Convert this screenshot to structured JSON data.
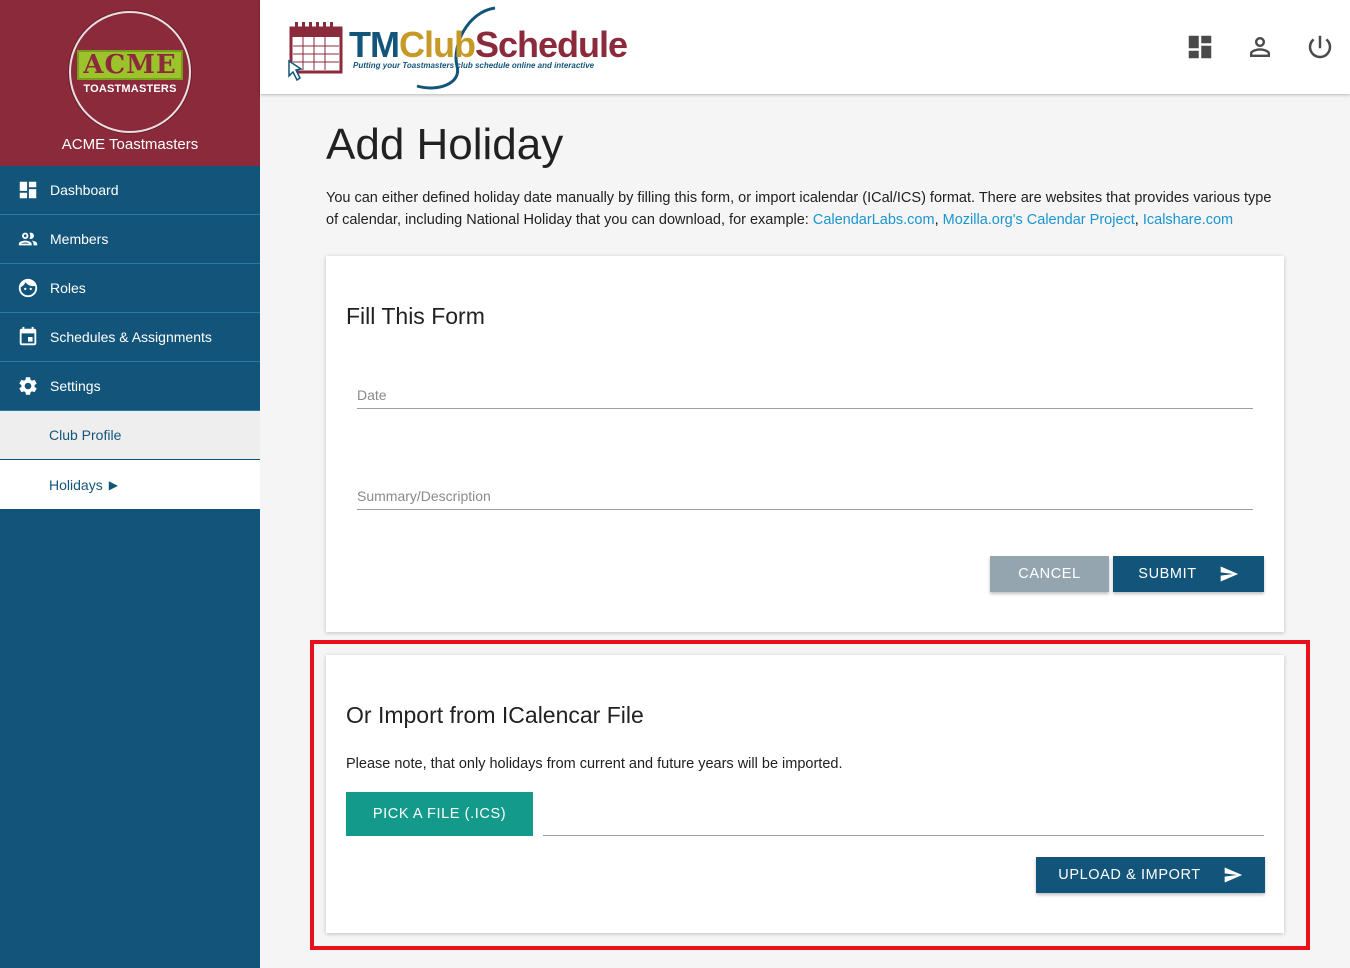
{
  "club": {
    "logo_main": "ACME",
    "logo_sub": "TOASTMASTERS",
    "name": "ACME Toastmasters"
  },
  "sidebar": {
    "items": [
      {
        "label": "Dashboard",
        "icon": "dashboard-icon"
      },
      {
        "label": "Members",
        "icon": "members-icon"
      },
      {
        "label": "Roles",
        "icon": "roles-icon"
      },
      {
        "label": "Schedules & Assignments",
        "icon": "calendar-icon"
      },
      {
        "label": "Settings",
        "icon": "gear-icon"
      }
    ],
    "sub_items": [
      {
        "label": "Club Profile"
      },
      {
        "label": "Holidays",
        "arrow": "▶"
      }
    ]
  },
  "brand": {
    "tm": "TM",
    "club": "Club",
    "schedule": "Schedule",
    "tagline": "Putting your Toastmasters club schedule online and interactive"
  },
  "topbar": {
    "icons": [
      "dashboard-icon",
      "user-icon",
      "power-icon"
    ]
  },
  "page": {
    "title": "Add Holiday",
    "intro_text": "You can either defined holiday date manually by filling this form, or import icalendar (ICal/ICS) format. There are websites that provides various type of calendar, including National Holiday that you can download, for example: ",
    "links": [
      "CalendarLabs.com",
      "Mozilla.org's Calendar Project",
      "Icalshare.com"
    ],
    "sep1": ", ",
    "sep2": ", "
  },
  "form": {
    "title": "Fill This Form",
    "date_placeholder": "Date",
    "summary_placeholder": "Summary/Description",
    "cancel_label": "CANCEL",
    "submit_label": "SUBMIT"
  },
  "import": {
    "title": "Or Import from ICalencar File",
    "note": "Please note, that only holidays from current and future years will be imported.",
    "pick_label": "PICK A FILE (.ICS)",
    "upload_label": "UPLOAD & IMPORT"
  },
  "colors": {
    "sidebar": "#13557a",
    "club_header": "#8b2a3b",
    "link": "#1a95d0",
    "pick_button": "#149a8a",
    "highlight": "#e8101a"
  }
}
